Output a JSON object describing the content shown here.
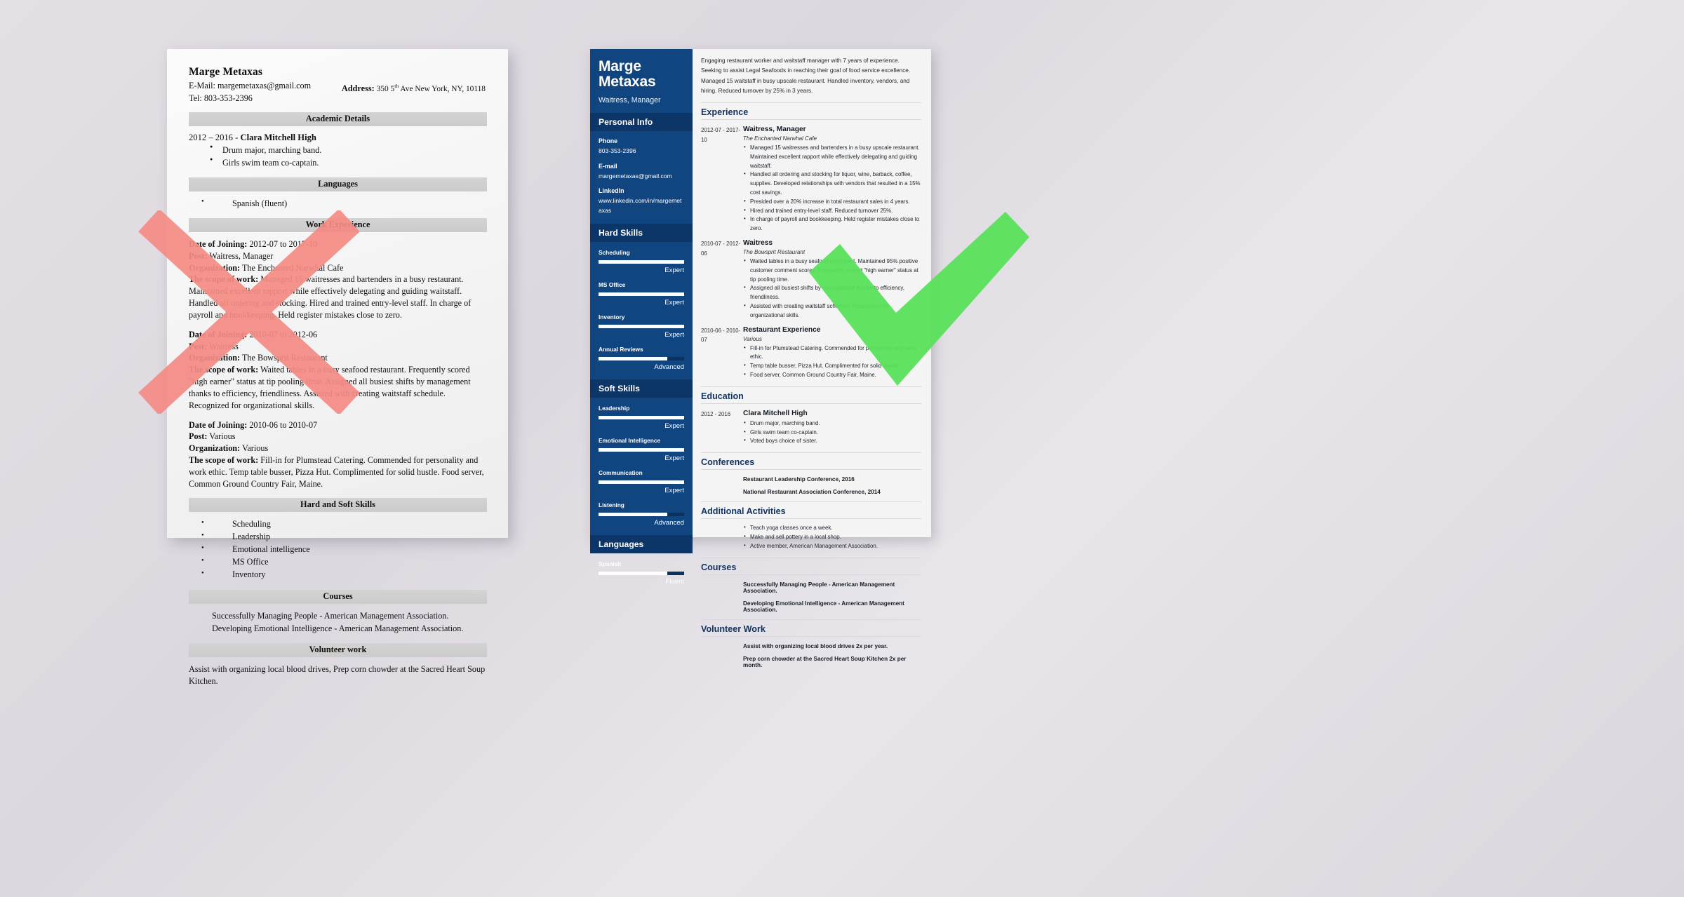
{
  "colors": {
    "sidebar_blue": "#11457f",
    "sidebar_header_blue": "#0c3568",
    "heading_navy": "#13335f",
    "x_mark_red": "#f58b85",
    "check_mark_green": "#5ae05a",
    "page_background": "#e3dfe4"
  },
  "bad_resume": {
    "name": "Marge Metaxas",
    "email_line": "E-Mail: margemetaxas@gmail.com",
    "tel_line": "Tel: 803-353-2396",
    "address_label": "Address:",
    "address_value_a": "350 5",
    "address_sup": "th",
    "address_value_b": " Ave New York, NY, 10118",
    "sections": {
      "academic": "Academic Details",
      "languages": "Languages",
      "work": "Work Experience",
      "skills": "Hard and Soft Skills",
      "courses": "Courses",
      "volunteer": "Volunteer work"
    },
    "academic": {
      "school_years": "2012 – 2016 - ",
      "school_name": "Clara Mitchell High",
      "bullets": [
        "Drum major, marching band.",
        "Girls swim team co-captain."
      ]
    },
    "languages": [
      "Spanish (fluent)"
    ],
    "jobs": [
      {
        "date_label": "Date of Joining:",
        "date_value": " 2012-07 to 2017-10",
        "post_label": "Post:",
        "post_value": " Waitress, Manager",
        "org_label": "Organization:",
        "org_value": " The Enchanted Narwhal Cafe",
        "scope_label": "The scope of work:",
        "scope_value": " Managed 15 waitresses and bartenders in a busy restaurant. Maintained excellent rapport while effectively delegating and guiding waitstaff. Handled all ordering and stocking. Hired and trained entry-level staff. In charge of payroll and bookkeeping. Held register mistakes close to zero."
      },
      {
        "date_label": "Date of Joining:",
        "date_value": " 2010-07 to 2012-06",
        "post_label": "Post:",
        "post_value": " Waitress",
        "org_label": "Organization:",
        "org_value": " The Bowsprit Restaurant",
        "scope_label": "The scope of work:",
        "scope_value": " Waited tables in a busy seafood restaurant. Frequently scored \"high earner\" status at tip pooling time. Assigned all busiest shifts by management thanks to efficiency, friendliness. Assisted with creating waitstaff schedule. Recognized for organizational skills."
      },
      {
        "date_label": "Date of Joining:",
        "date_value": " 2010-06 to 2010-07",
        "post_label": "Post:",
        "post_value": " Various",
        "org_label": "Organization:",
        "org_value": " Various",
        "scope_label": "The scope of work:",
        "scope_value": " Fill-in for Plumstead Catering. Commended for personality and work ethic. Temp table busser, Pizza Hut. Complimented for solid hustle. Food server, Common Ground Country Fair, Maine."
      }
    ],
    "skills": [
      "Scheduling",
      "Leadership",
      "Emotional intelligence",
      "MS Office",
      "Inventory"
    ],
    "courses": [
      "Successfully Managing People - American Management Association.",
      "Developing Emotional Intelligence - American Management Association."
    ],
    "volunteer": "Assist with organizing local blood drives, Prep corn chowder at the Sacred Heart Soup Kitchen."
  },
  "good_resume": {
    "sidebar": {
      "name_line1": "Marge",
      "name_line2": "Metaxas",
      "job_title": "Waitress, Manager",
      "personal_info_header": "Personal Info",
      "fields": [
        {
          "label": "Phone",
          "value": "803-353-2396"
        },
        {
          "label": "E-mail",
          "value": "margemetaxas@gmail.com"
        },
        {
          "label": "LinkedIn",
          "value": "www.linkedin.com/in/margemetaxas"
        }
      ],
      "hard_skills_header": "Hard Skills",
      "hard_skills": [
        {
          "name": "Scheduling",
          "level": "Expert",
          "fill": 100
        },
        {
          "name": "MS Office",
          "level": "Expert",
          "fill": 100
        },
        {
          "name": "Inventory",
          "level": "Expert",
          "fill": 100
        },
        {
          "name": "Annual Reviews",
          "level": "Advanced",
          "fill": 80
        }
      ],
      "soft_skills_header": "Soft Skills",
      "soft_skills": [
        {
          "name": "Leadership",
          "level": "Expert",
          "fill": 100
        },
        {
          "name": "Emotional Intelligence",
          "level": "Expert",
          "fill": 100
        },
        {
          "name": "Communication",
          "level": "Expert",
          "fill": 100
        },
        {
          "name": "Listening",
          "level": "Advanced",
          "fill": 80
        }
      ],
      "languages_header": "Languages",
      "languages": [
        {
          "name": "Spanish",
          "level": "Fluent",
          "fill": 80
        }
      ]
    },
    "main": {
      "summary": "Engaging restaurant worker and waitstaff manager with 7 years of experience. Seeking to assist Legal Seafoods in reaching their goal of food service excellence. Managed 15 waitstaff in busy upscale restaurant. Handled inventory, vendors, and hiring. Reduced turnover by 25% in 3 years.",
      "experience_header": "Experience",
      "experience": [
        {
          "date": "2012-07 - 2017-10",
          "role": "Waitress, Manager",
          "org": "The Enchanted Narwhal Cafe",
          "bullets": [
            "Managed 15 waitresses and bartenders in a busy upscale restaurant. Maintained excellent rapport while effectively delegating and guiding waitstaff.",
            "Handled all ordering and stocking for liquor, wine, barback, coffee, supplies. Developed relationships with vendors that resulted in a 15% cost savings.",
            "Presided over a 20% increase in total restaurant sales in 4 years.",
            "Hired and trained entry-level staff. Reduced turnover 25%.",
            "In charge of payroll and bookkeeping. Held register mistakes close to zero."
          ]
        },
        {
          "date": "2010-07 - 2012-06",
          "role": "Waitress",
          "org": "The Bowsprit Restaurant",
          "bullets": [
            "Waited tables in a busy seafood restaurant. Maintained 95% positive customer comment scores. Frequently scored \"high earner\" status at tip pooling time.",
            "Assigned all busiest shifts by management thanks to efficiency, friendliness.",
            "Assisted with creating waitstaff schedule. Recognized for organizational skills."
          ]
        },
        {
          "date": "2010-06 - 2010-07",
          "role": "Restaurant Experience",
          "org": "Various",
          "bullets": [
            "Fill-in for Plumstead Catering. Commended for personality and work ethic.",
            "Temp table busser, Pizza Hut. Complimented for solid hustle.",
            "Food server, Common Ground Country Fair, Maine."
          ]
        }
      ],
      "education_header": "Education",
      "education": [
        {
          "date": "2012 - 2016",
          "role": "Clara Mitchell High",
          "bullets": [
            "Drum major, marching band.",
            "Girls swim team co-captain.",
            "Voted boys choice of sister."
          ]
        }
      ],
      "conferences_header": "Conferences",
      "conferences": [
        "Restaurant Leadership Conference, 2016",
        "National Restaurant Association Conference, 2014"
      ],
      "activities_header": "Additional Activities",
      "activities": [
        "Teach yoga classes once a week.",
        "Make and sell pottery in a local shop.",
        "Active member, American Management Association."
      ],
      "courses_header": "Courses",
      "courses": [
        "Successfully Managing People - American Management Association.",
        "Developing Emotional Intelligence - American Management Association."
      ],
      "volunteer_header": "Volunteer Work",
      "volunteer": [
        "Assist with organizing local blood drives 2x per year.",
        "Prep corn chowder at the Sacred Heart Soup Kitchen 2x per month."
      ]
    }
  },
  "marks": {
    "reject": "x-mark",
    "approve": "check-mark"
  }
}
